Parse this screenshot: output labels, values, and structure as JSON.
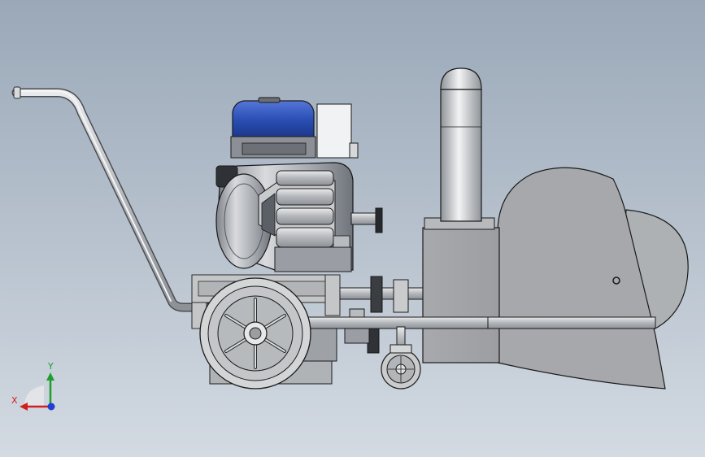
{
  "viewport": {
    "background_top": "#9aa8b8",
    "background_bottom": "#d3dae2"
  },
  "model": {
    "fuel_tank_color": "#2a4fb5",
    "metal_color": "#b9bcc0",
    "edge_color": "#2b2b2b"
  },
  "triad": {
    "x_label": "X",
    "y_label": "Y",
    "x_color": "#d11f1f",
    "y_color": "#1f9d2e",
    "z_color": "#1f3fd1"
  }
}
